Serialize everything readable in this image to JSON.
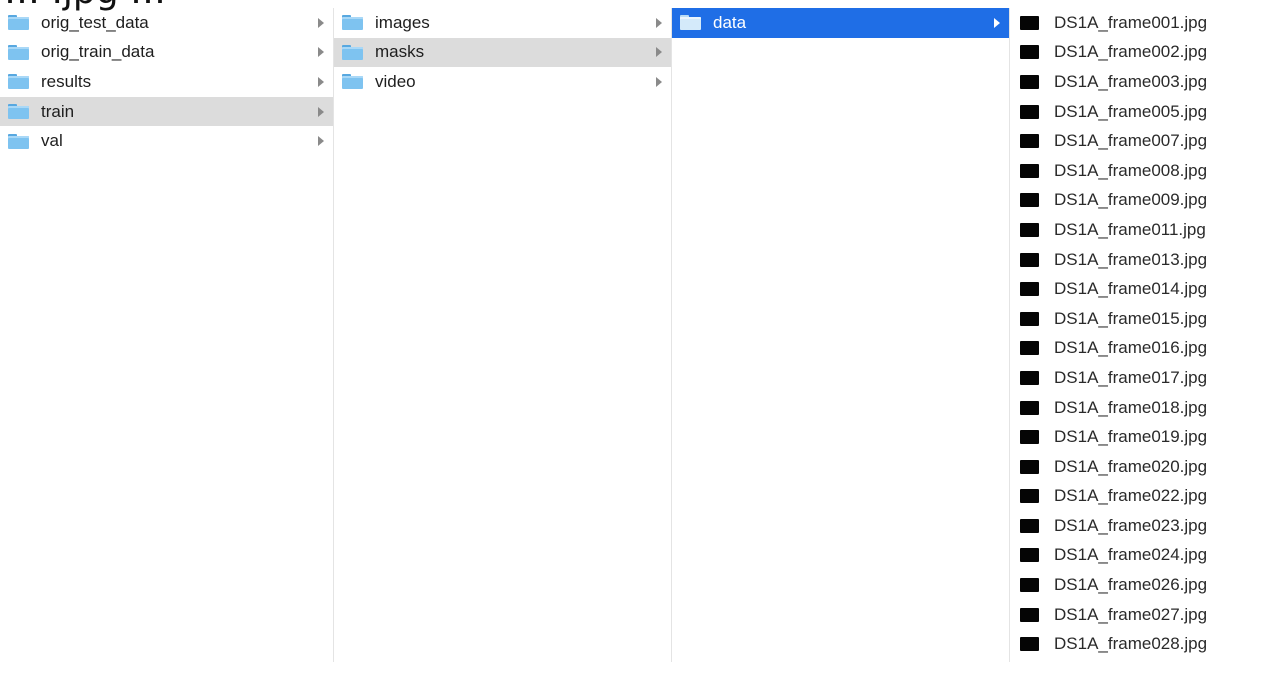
{
  "caption": "… .jpg …",
  "columns": [
    {
      "items": [
        {
          "label": "orig_test_data",
          "state": "normal"
        },
        {
          "label": "orig_train_data",
          "state": "normal"
        },
        {
          "label": "results",
          "state": "normal"
        },
        {
          "label": "train",
          "state": "selected-inactive"
        },
        {
          "label": "val",
          "state": "normal"
        }
      ]
    },
    {
      "items": [
        {
          "label": "images",
          "state": "normal"
        },
        {
          "label": "masks",
          "state": "selected-inactive"
        },
        {
          "label": "video",
          "state": "normal"
        }
      ]
    },
    {
      "items": [
        {
          "label": "data",
          "state": "selected-active"
        }
      ]
    }
  ],
  "files": [
    "DS1A_frame001.jpg",
    "DS1A_frame002.jpg",
    "DS1A_frame003.jpg",
    "DS1A_frame005.jpg",
    "DS1A_frame007.jpg",
    "DS1A_frame008.jpg",
    "DS1A_frame009.jpg",
    "DS1A_frame011.jpg",
    "DS1A_frame013.jpg",
    "DS1A_frame014.jpg",
    "DS1A_frame015.jpg",
    "DS1A_frame016.jpg",
    "DS1A_frame017.jpg",
    "DS1A_frame018.jpg",
    "DS1A_frame019.jpg",
    "DS1A_frame020.jpg",
    "DS1A_frame022.jpg",
    "DS1A_frame023.jpg",
    "DS1A_frame024.jpg",
    "DS1A_frame026.jpg",
    "DS1A_frame027.jpg",
    "DS1A_frame028.jpg"
  ],
  "colors": {
    "selection_active": "#1f6ee6",
    "selection_inactive": "#dcdcdc",
    "folder": "#7ec3f0"
  },
  "icons": {
    "folder": "folder-icon",
    "file": "image-file-icon",
    "chevron": "chevron-right-icon"
  }
}
